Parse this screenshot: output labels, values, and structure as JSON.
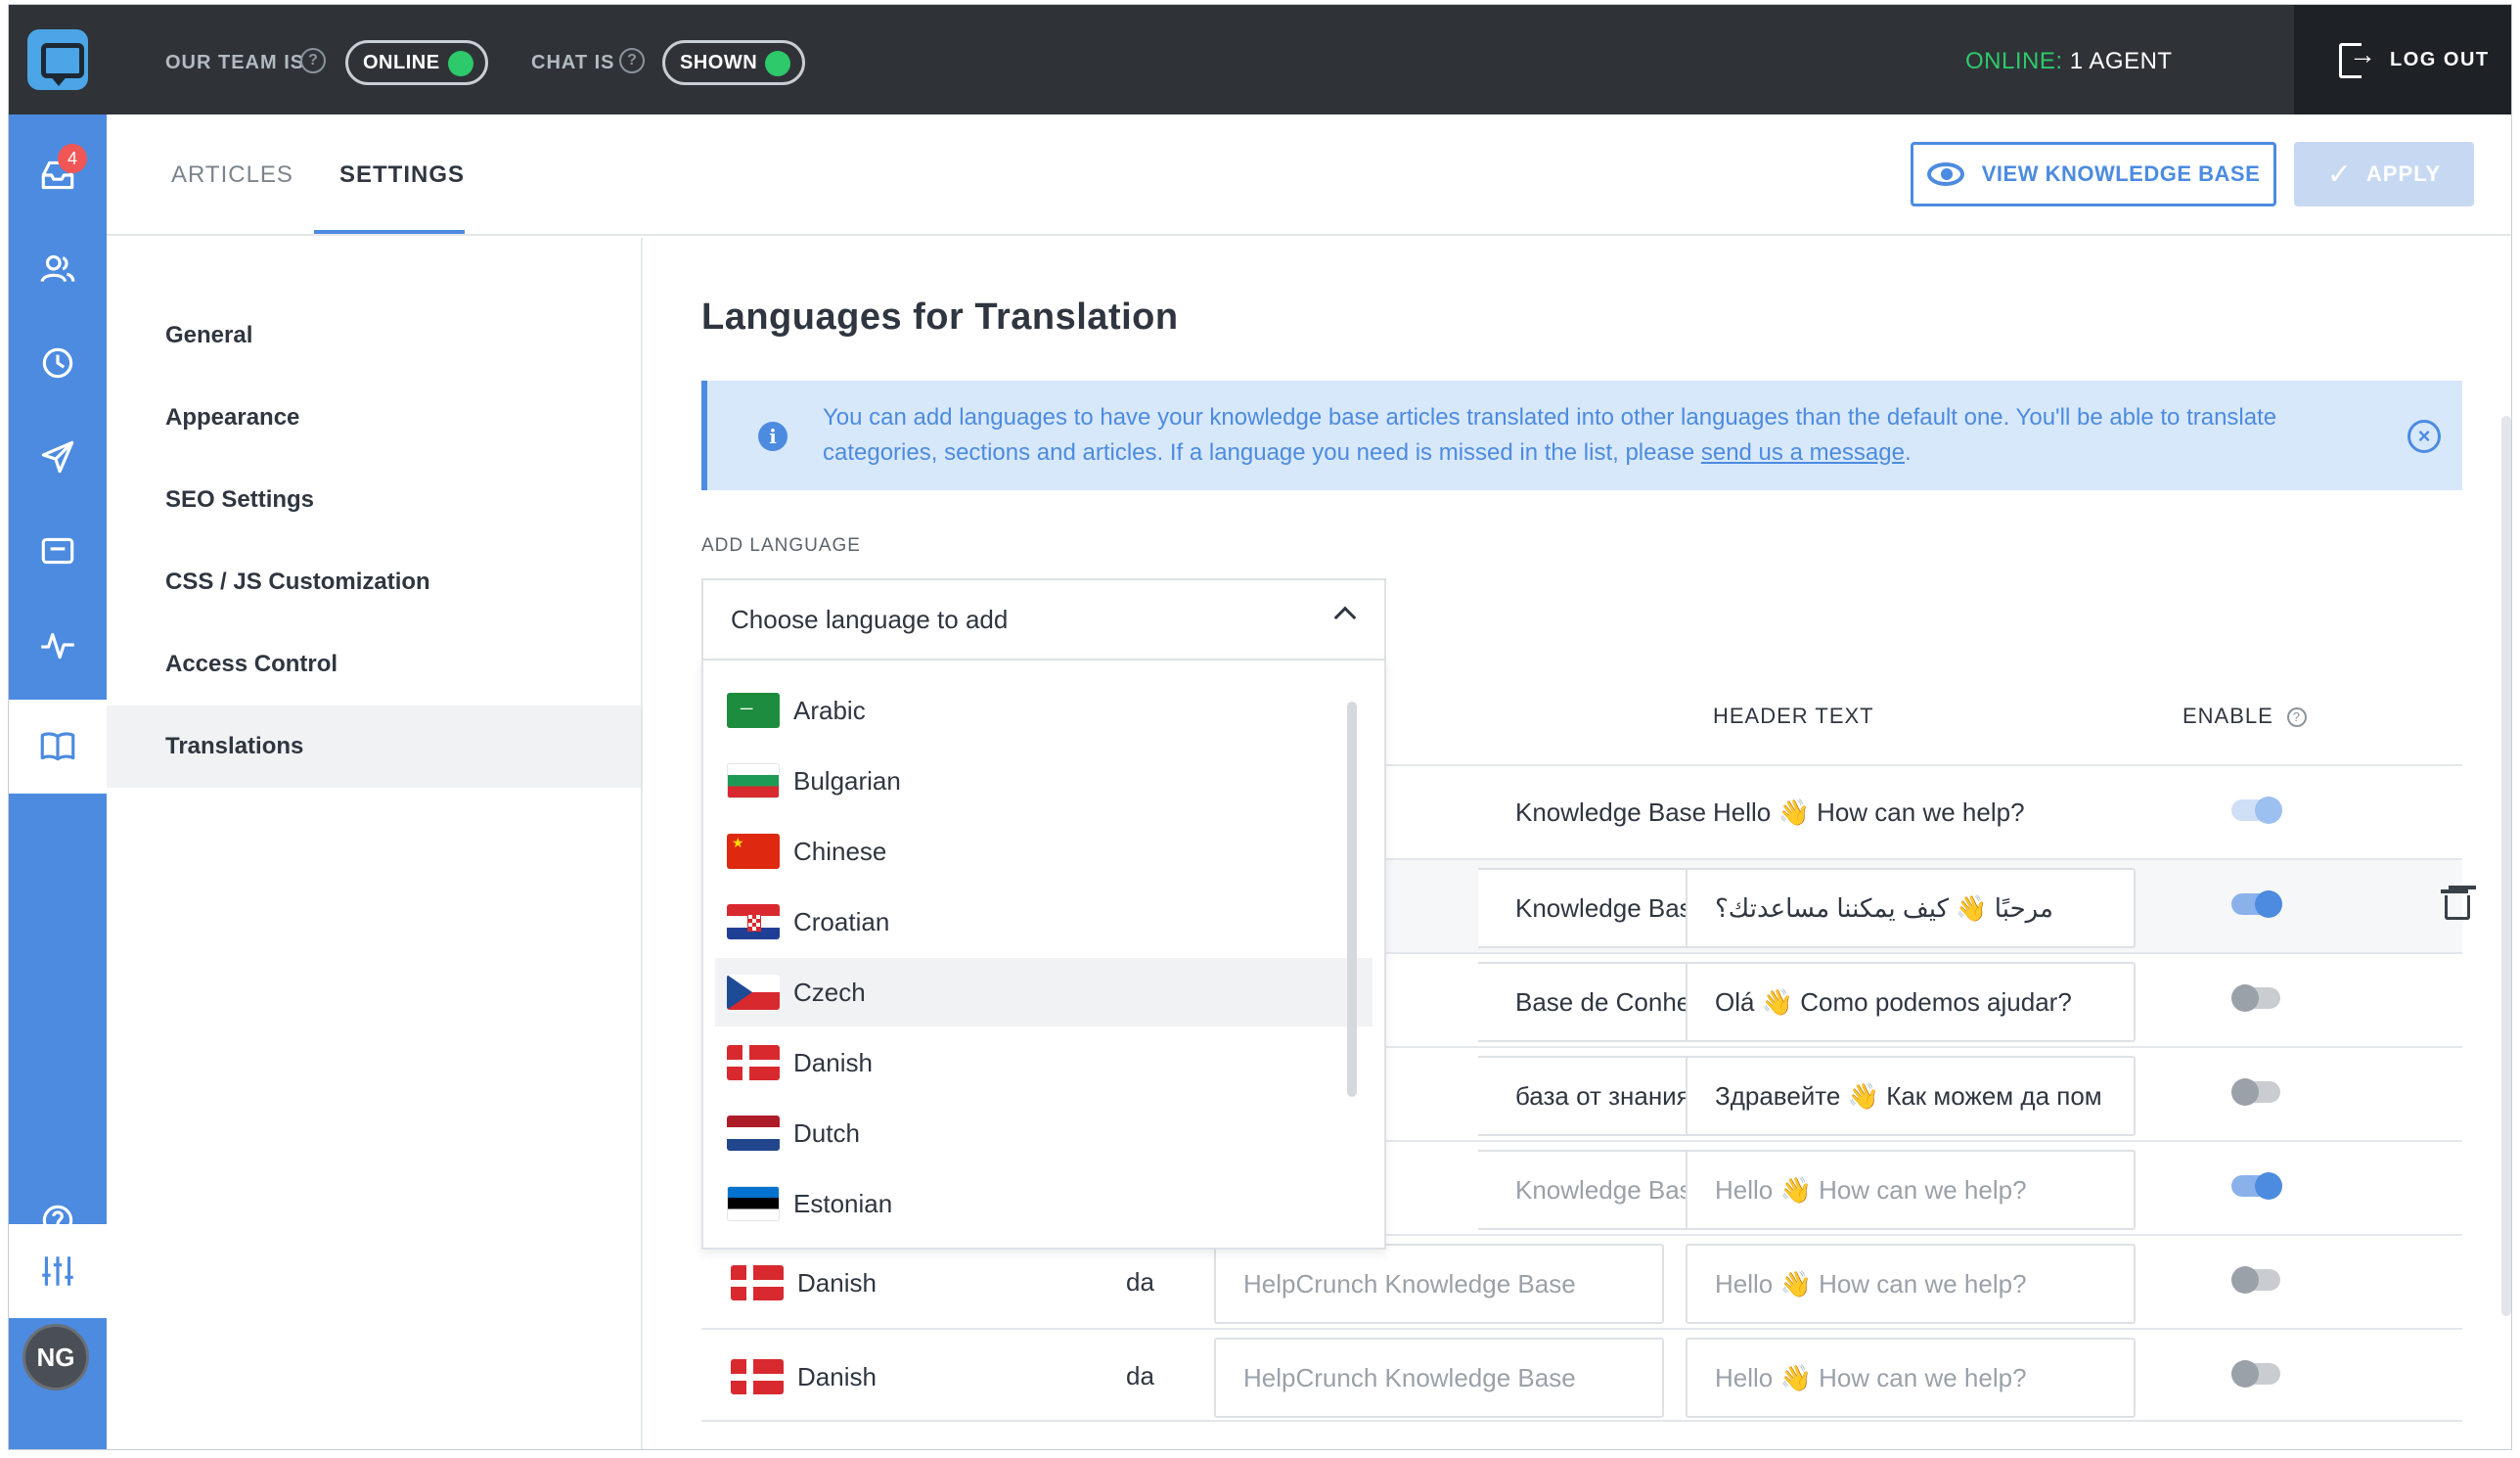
{
  "topbar": {
    "team_label": "OUR TEAM IS",
    "team_status": "ONLINE",
    "chat_label": "CHAT IS",
    "chat_status": "SHOWN",
    "online_label": "ONLINE:",
    "online_value": "1 AGENT",
    "logout_label": "LOG OUT"
  },
  "sidenav": {
    "badge_count": "4",
    "avatar_initials": "NG",
    "items": [
      "inbox-icon",
      "contacts-icon",
      "clock-icon",
      "send-icon",
      "widget-icon",
      "activity-icon",
      "book-icon",
      "help-icon",
      "sliders-icon"
    ]
  },
  "tabs": {
    "articles": "ARTICLES",
    "settings": "SETTINGS"
  },
  "header_buttons": {
    "view_kb": "VIEW KNOWLEDGE BASE",
    "apply": "APPLY"
  },
  "settings_menu": {
    "items": [
      "General",
      "Appearance",
      "SEO Settings",
      "CSS / JS Customization",
      "Access Control",
      "Translations"
    ],
    "active": "Translations"
  },
  "main": {
    "title": "Languages for Translation",
    "info_text": "You can add languages to have your knowledge base articles translated into other languages than the default one. You'll be able to translate categories, sections and articles. If a language you need is missed in the list, please ",
    "info_link": "send us a message",
    "info_end": ".",
    "add_language_label": "ADD LANGUAGE",
    "dropdown_placeholder": "Choose language to add"
  },
  "dropdown_options": [
    "Arabic",
    "Bulgarian",
    "Chinese",
    "Croatian",
    "Czech",
    "Danish",
    "Dutch",
    "Estonian"
  ],
  "table": {
    "header_text_col": "HEADER TEXT",
    "enable_col": "ENABLE",
    "rows": [
      {
        "name": "Knowledge Base",
        "header": "Hello 👋 How can we help?",
        "enabled": true
      },
      {
        "name": "Knowledge Base",
        "header": "مرحبًا 👋 كيف يمكننا مساعدتك؟",
        "enabled": true
      },
      {
        "name": "Base de Conhecimen",
        "header": "Olá 👋 Como podemos ajudar?",
        "enabled": false
      },
      {
        "name": "база от знания",
        "header": "Здравейте 👋 Как можем да пом",
        "enabled": false
      },
      {
        "name": "Knowledge Base",
        "header": "Hello 👋 How can we help?",
        "enabled": true
      },
      {
        "lang": "Danish",
        "code": "da",
        "name": "HelpCrunch Knowledge Base",
        "header": "Hello 👋 How can we help?",
        "enabled": false
      },
      {
        "lang": "Danish",
        "code": "da",
        "name": "HelpCrunch Knowledge Base",
        "header": "Hello 👋 How can we help?",
        "enabled": false
      }
    ]
  },
  "colors": {
    "accent": "#4c8be0",
    "topbar": "#2f3338",
    "online_green": "#2ec96a",
    "badge_red": "#f15656"
  }
}
